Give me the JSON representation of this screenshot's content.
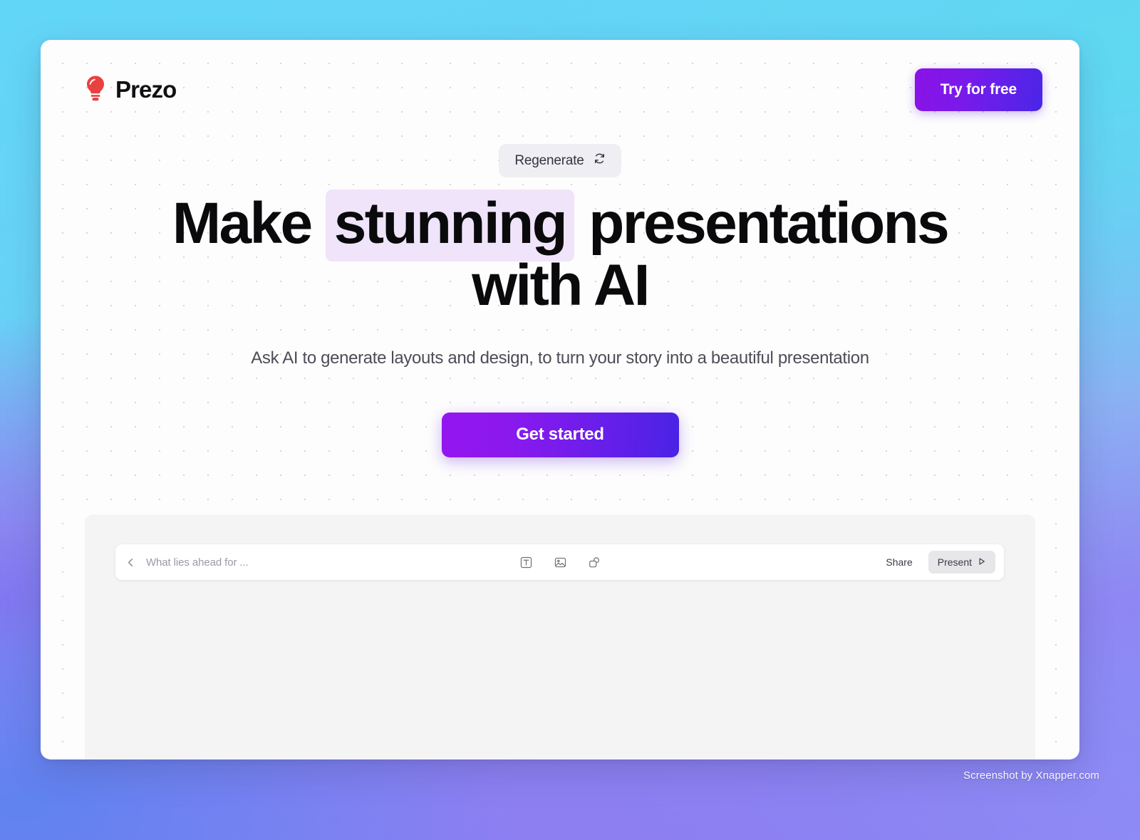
{
  "background": {
    "colors": {
      "cyan": "#5fd8f2",
      "blue": "#5f83f0",
      "purple": "#8e72f0"
    }
  },
  "header": {
    "brand_name": "Prezo",
    "brand_icon": "lightbulb-icon",
    "brand_icon_color": "#e8413f",
    "cta": {
      "label": "Try for free",
      "gradient_from": "#8b12e6",
      "gradient_to": "#4a26e8"
    }
  },
  "hero": {
    "regenerate": {
      "label": "Regenerate",
      "icon": "refresh-icon"
    },
    "headline": {
      "part1": "Make ",
      "highlight": "stunning",
      "part2": " presentations with AI",
      "highlight_color": "#f0e4fb"
    },
    "subheadline": "Ask AI to generate layouts and design, to turn your story into a beautiful presentation",
    "primary_cta": {
      "label": "Get started",
      "gradient_from": "#9416ef",
      "gradient_to": "#4a23e6"
    }
  },
  "preview": {
    "toolbar": {
      "back_icon": "chevron-left-icon",
      "deck_title": "What lies ahead for ...",
      "tools": [
        {
          "name": "text-tool-icon",
          "label": "Text"
        },
        {
          "name": "image-tool-icon",
          "label": "Image"
        },
        {
          "name": "shapes-tool-icon",
          "label": "Shapes"
        }
      ],
      "share_label": "Share",
      "present_label": "Present",
      "present_icon": "play-icon"
    }
  },
  "watermark": {
    "text": "Screenshot by Xnapper.com"
  }
}
